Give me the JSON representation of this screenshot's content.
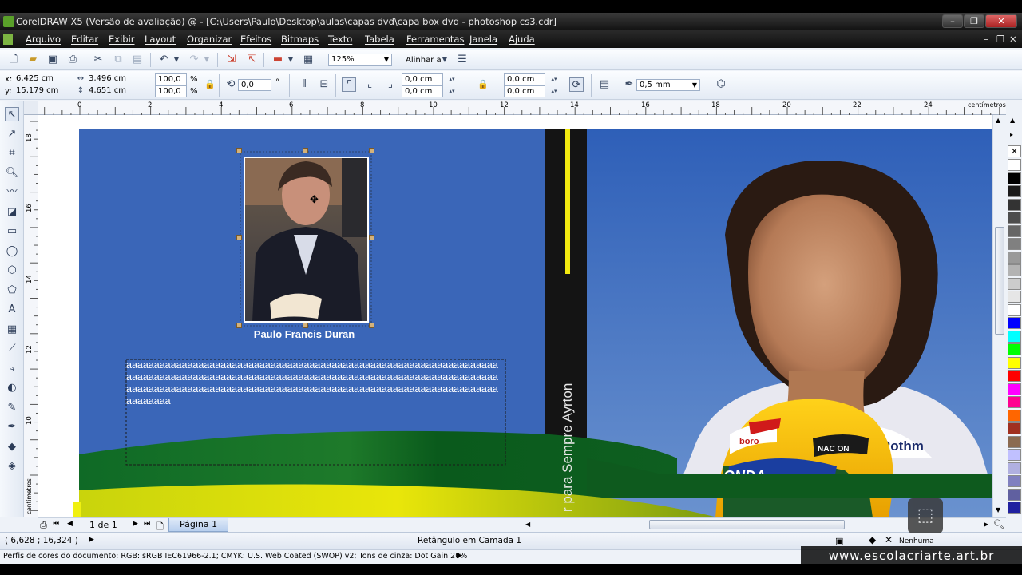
{
  "window": {
    "title": "CorelDRAW X5 (Versão de avaliação) @ - [C:\\Users\\Paulo\\Desktop\\aulas\\capas dvd\\capa box dvd - photoshop cs3.cdr]"
  },
  "menu": [
    "Arquivo",
    "Editar",
    "Exibir",
    "Layout",
    "Organizar",
    "Efeitos",
    "Bitmaps",
    "Texto",
    "Tabela",
    "Ferramentas",
    "Janela",
    "Ajuda"
  ],
  "toolbar": {
    "zoom": "125%",
    "align_label": "Alinhar a"
  },
  "propbar": {
    "x_label": "x:",
    "x_value": "6,425 cm",
    "y_label": "y:",
    "y_value": "15,179 cm",
    "width_value": "3,496 cm",
    "height_value": "4,651 cm",
    "scale_x": "100,0",
    "scale_y": "100,0",
    "percent": "%",
    "rotation": "0,0",
    "degree": "°",
    "corner1": "0,0 cm",
    "corner2": "0,0 cm",
    "corner3": "0,0 cm",
    "corner4": "0,0 cm",
    "outline": "0,5 mm"
  },
  "ruler": {
    "h_labels": [
      "0",
      "2",
      "4",
      "6",
      "8",
      "10",
      "12",
      "14",
      "16",
      "18",
      "20",
      "22",
      "24"
    ],
    "unit": "centímetros",
    "v_labels": [
      "18",
      "16",
      "14",
      "12",
      "10"
    ],
    "v_unit": "centímetros"
  },
  "artwork": {
    "author_name": "Paulo Francis Duran",
    "placeholder_text": "aaaaaaaaaaaaaaaaaaaaaaaaaaaaaaaaaaaaaaaaaaaaaaaaaaaaaaaaaaaaaaaaaaaaaaaaaaaaaaaaaaaaaaaaaaaaaaaaaaaaaaaaaaaaaaaaaaaaaaaaaaaaaaaaaaaaaaaaaaaaaaaaaaaaaaaaaaaaaaaaaaaaaaaaaaaaaaaaaaaaaaaaaaaaaaaaaaaaaaaaaaaaaaaaa",
    "spine_text": "r para Sempre Ayrton",
    "helmet_brand1": "NAC ON",
    "helmet_brand2": "ONDA",
    "helmet_brand3": "boro",
    "suit_brand": "Rothm"
  },
  "nav": {
    "page_count": "1 de 1",
    "page_tab": "Página 1"
  },
  "status": {
    "coords": "( 6,628 ; 16,324 )",
    "object": "Retângulo em Camada 1",
    "fill_none": "Nenhuma",
    "color_profile": "Perfis de cores do documento: RGB: sRGB IEC61966-2.1; CMYK: U.S. Web Coated (SWOP) v2; Tons de cinza: Dot Gain 20%"
  },
  "watermark": "www.escolacriarte.art.br",
  "colors": {
    "bg_blue": "#3a62b4",
    "green": "#1a6a2a",
    "yellow": "#f1e10a",
    "spine": "#151515"
  },
  "palette": [
    "#ffffff",
    "#000000",
    "#1a1a1a",
    "#333333",
    "#4d4d4d",
    "#666666",
    "#808080",
    "#999999",
    "#b3b3b3",
    "#cccccc",
    "#e6e6e6",
    "#ffffff",
    "#0000ff",
    "#00ffff",
    "#00ff00",
    "#ffff00",
    "#ff0000",
    "#ff00ff",
    "#ff0090",
    "#ff6600",
    "#a03020",
    "#8a6a50",
    "#c0c0ff",
    "#b0b0e0",
    "#8080c0",
    "#6060a0",
    "#2020a0"
  ]
}
